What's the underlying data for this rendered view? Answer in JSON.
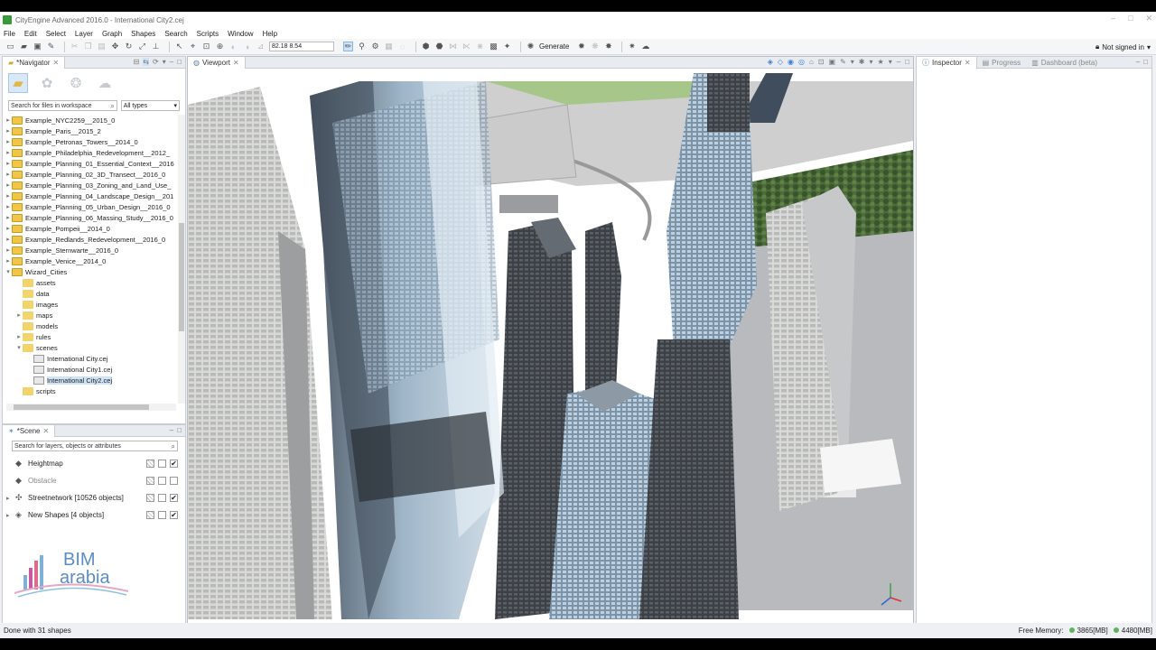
{
  "window": {
    "title": "CityEngine Advanced 2016.0 - International City2.cej",
    "controls": [
      "–",
      "□",
      "✕"
    ]
  },
  "menu": [
    "File",
    "Edit",
    "Select",
    "Layer",
    "Graph",
    "Shapes",
    "Search",
    "Scripts",
    "Window",
    "Help"
  ],
  "toolbar": {
    "coordinates": "82.18 8.54",
    "generate_label": "Generate",
    "signin_label": "Not signed in"
  },
  "navigator": {
    "tab_label": "*Navigator",
    "search_placeholder": "Search for files in workspace",
    "filter_value": "All types",
    "tree": [
      {
        "label": "Example_NYC2259__2015_0",
        "level": 0,
        "type": "proj",
        "arrow": "▸"
      },
      {
        "label": "Example_Paris__2015_2",
        "level": 0,
        "type": "proj",
        "arrow": "▸"
      },
      {
        "label": "Example_Petronas_Towers__2014_0",
        "level": 0,
        "type": "proj",
        "arrow": "▸"
      },
      {
        "label": "Example_Philadelphia_Redevelopment__2012_",
        "level": 0,
        "type": "proj",
        "arrow": "▸"
      },
      {
        "label": "Example_Planning_01_Essential_Context__2016",
        "level": 0,
        "type": "proj",
        "arrow": "▸"
      },
      {
        "label": "Example_Planning_02_3D_Transect__2016_0",
        "level": 0,
        "type": "proj",
        "arrow": "▸"
      },
      {
        "label": "Example_Planning_03_Zoning_and_Land_Use_",
        "level": 0,
        "type": "proj",
        "arrow": "▸"
      },
      {
        "label": "Example_Planning_04_Landscape_Design__201",
        "level": 0,
        "type": "proj",
        "arrow": "▸"
      },
      {
        "label": "Example_Planning_05_Urban_Design__2016_0",
        "level": 0,
        "type": "proj",
        "arrow": "▸"
      },
      {
        "label": "Example_Planning_06_Massing_Study__2016_0",
        "level": 0,
        "type": "proj",
        "arrow": "▸"
      },
      {
        "label": "Example_Pompeii__2014_0",
        "level": 0,
        "type": "proj",
        "arrow": "▸"
      },
      {
        "label": "Example_Redlands_Redevelopment__2016_0",
        "level": 0,
        "type": "proj",
        "arrow": "▸"
      },
      {
        "label": "Example_Sternwarte__2016_0",
        "level": 0,
        "type": "proj",
        "arrow": "▸"
      },
      {
        "label": "Example_Venice__2014_0",
        "level": 0,
        "type": "proj",
        "arrow": "▸"
      },
      {
        "label": "Wizard_Cities",
        "level": 0,
        "type": "proj",
        "arrow": "▾"
      },
      {
        "label": "assets",
        "level": 1,
        "type": "folder",
        "arrow": ""
      },
      {
        "label": "data",
        "level": 1,
        "type": "folder",
        "arrow": ""
      },
      {
        "label": "images",
        "level": 1,
        "type": "folder",
        "arrow": ""
      },
      {
        "label": "maps",
        "level": 1,
        "type": "folder",
        "arrow": "▸"
      },
      {
        "label": "models",
        "level": 1,
        "type": "folder",
        "arrow": ""
      },
      {
        "label": "rules",
        "level": 1,
        "type": "folder",
        "arrow": "▸"
      },
      {
        "label": "scenes",
        "level": 1,
        "type": "folder",
        "arrow": "▾"
      },
      {
        "label": "International City.cej",
        "level": 2,
        "type": "file",
        "arrow": ""
      },
      {
        "label": "International City1.cej",
        "level": 2,
        "type": "file",
        "arrow": ""
      },
      {
        "label": "International City2.cej",
        "level": 2,
        "type": "file",
        "arrow": "",
        "selected": true
      },
      {
        "label": "scripts",
        "level": 1,
        "type": "folder",
        "arrow": ""
      }
    ]
  },
  "scene": {
    "tab_label": "*Scene",
    "search_placeholder": "Search for layers, objects or attributes",
    "layers": [
      {
        "label": "Heightmap",
        "icon": "◆",
        "checked": true,
        "dim": false,
        "arrow": ""
      },
      {
        "label": "Obstacle",
        "icon": "◆",
        "checked": false,
        "dim": true,
        "arrow": ""
      },
      {
        "label": "Streetnetwork [10526 objects]",
        "icon": "✣",
        "checked": true,
        "dim": false,
        "arrow": "▸"
      },
      {
        "label": "New Shapes [4 objects]",
        "icon": "◈",
        "checked": true,
        "dim": false,
        "arrow": "▸"
      }
    ]
  },
  "logo": {
    "line1": "BIM",
    "line2": "arabia"
  },
  "viewport": {
    "tab_label": "Viewport"
  },
  "inspector": {
    "tabs": [
      "Inspector",
      "Progress",
      "Dashboard (beta)"
    ]
  },
  "status": {
    "message": "Done with 31 shapes",
    "free_memory_label": "Free Memory:",
    "mem1": "3865[MB]",
    "mem2": "4480[MB]"
  },
  "colors": {
    "accent": "#3a7fd5",
    "selection": "#cfe3f7",
    "ok_green": "#5fb35f",
    "sky": "#ffffff",
    "ground": "#cfcfcf"
  }
}
